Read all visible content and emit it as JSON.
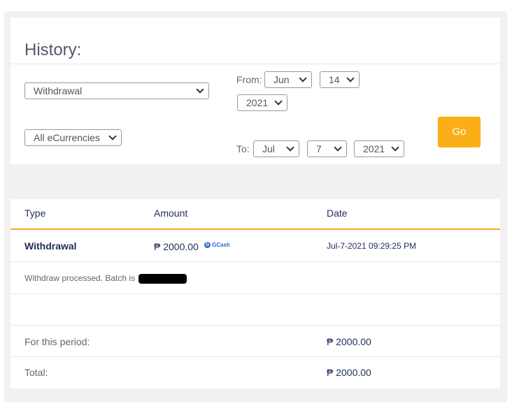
{
  "header": {
    "title": "History:"
  },
  "filters": {
    "type_select": "Withdrawal",
    "currency_select": "All eCurrencies",
    "from_label": "From:",
    "from_month": "Jun",
    "from_day": "14",
    "from_year": "2021",
    "to_label": "To:",
    "to_month": "Jul",
    "to_day": "7",
    "to_year": "2021",
    "go_label": "Go"
  },
  "table": {
    "columns": [
      "Type",
      "Amount",
      "Date"
    ],
    "row": {
      "type": "Withdrawal",
      "amount": "₱ 2000.00",
      "provider": "GCash",
      "date": "Jul-7-2021 09:29:25 PM",
      "note": "Withdraw processed. Batch is"
    },
    "summary": {
      "period_label": "For this period:",
      "period_value": "₱ 2000.00",
      "total_label": "Total:",
      "total_value": "₱ 2000.00"
    }
  }
}
